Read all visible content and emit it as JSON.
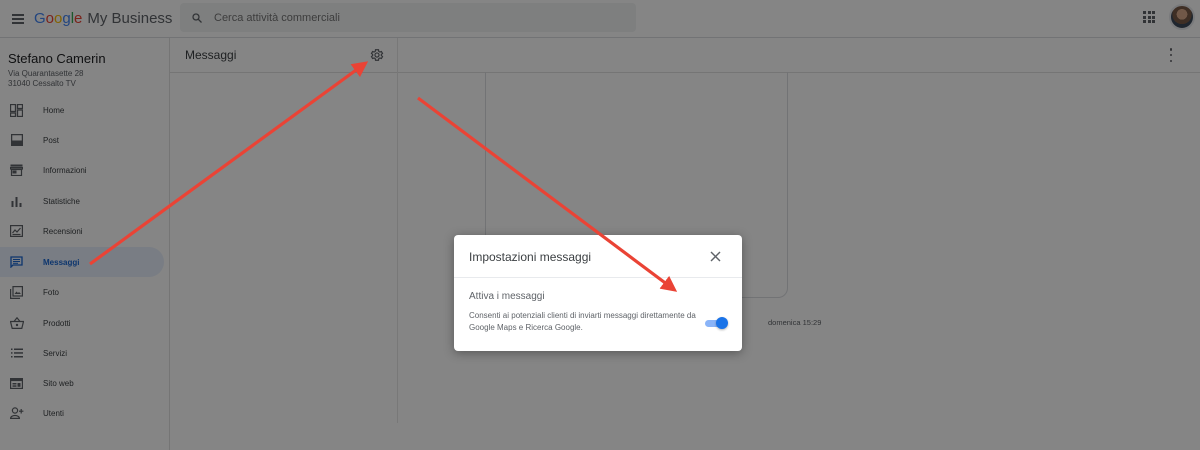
{
  "app": {
    "logo_google": [
      "G",
      "o",
      "o",
      "g",
      "l",
      "e"
    ],
    "product": "My Business",
    "search_placeholder": "Cerca attività commerciali"
  },
  "sidebar": {
    "business_name": "Stefano Camerin",
    "address_line1": "Via Quarantasette 28",
    "address_line2": "31040 Cessalto TV",
    "items": [
      {
        "label": "Home",
        "icon": "dashboard-icon"
      },
      {
        "label": "Post",
        "icon": "post-icon"
      },
      {
        "label": "Informazioni",
        "icon": "store-icon"
      },
      {
        "label": "Statistiche",
        "icon": "bar-chart-icon"
      },
      {
        "label": "Recensioni",
        "icon": "reviews-icon"
      },
      {
        "label": "Messaggi",
        "icon": "chat-icon",
        "active": true
      },
      {
        "label": "Foto",
        "icon": "photo-library-icon"
      },
      {
        "label": "Prodotti",
        "icon": "basket-icon"
      },
      {
        "label": "Servizi",
        "icon": "list-icon"
      },
      {
        "label": "Sito web",
        "icon": "web-icon"
      },
      {
        "label": "Utenti",
        "icon": "add-user-icon"
      }
    ]
  },
  "main": {
    "title": "Messaggi",
    "message_time": "domenica 15:29"
  },
  "dialog": {
    "title": "Impostazioni messaggi",
    "setting_label": "Attiva i messaggi",
    "setting_description": "Consenti ai potenziali clienti di inviarti messaggi direttamente da Google Maps e Ricerca Google.",
    "toggle_on": true
  },
  "colors": {
    "accent": "#1a73e8",
    "active_bg": "#e8f0fe",
    "arrow": "#ea4335"
  }
}
